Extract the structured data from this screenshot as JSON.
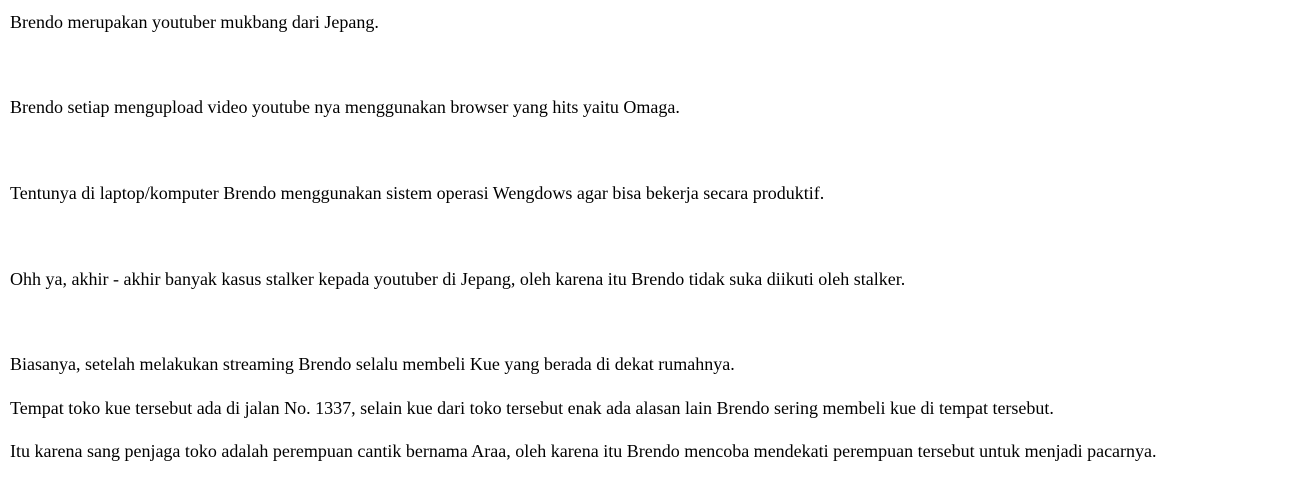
{
  "story": {
    "paragraphs": [
      "Brendo merupakan youtuber mukbang dari Jepang.",
      "Brendo setiap mengupload video youtube nya menggunakan browser yang hits yaitu Omaga.",
      "Tentunya di laptop/komputer Brendo menggunakan sistem operasi Wengdows agar bisa bekerja secara produktif.",
      "Ohh ya, akhir - akhir banyak kasus stalker kepada youtuber di Jepang, oleh karena itu Brendo tidak suka diikuti oleh stalker.",
      "Biasanya, setelah melakukan streaming Brendo selalu membeli Kue yang berada di dekat rumahnya.",
      "Tempat toko kue tersebut ada di jalan No. 1337, selain kue dari toko tersebut enak ada alasan lain Brendo sering membeli kue di tempat tersebut.",
      "Itu karena sang penjaga toko adalah perempuan cantik bernama Araa, oleh karena itu Brendo mencoba mendekati perempuan tersebut untuk menjadi pacarnya."
    ]
  }
}
